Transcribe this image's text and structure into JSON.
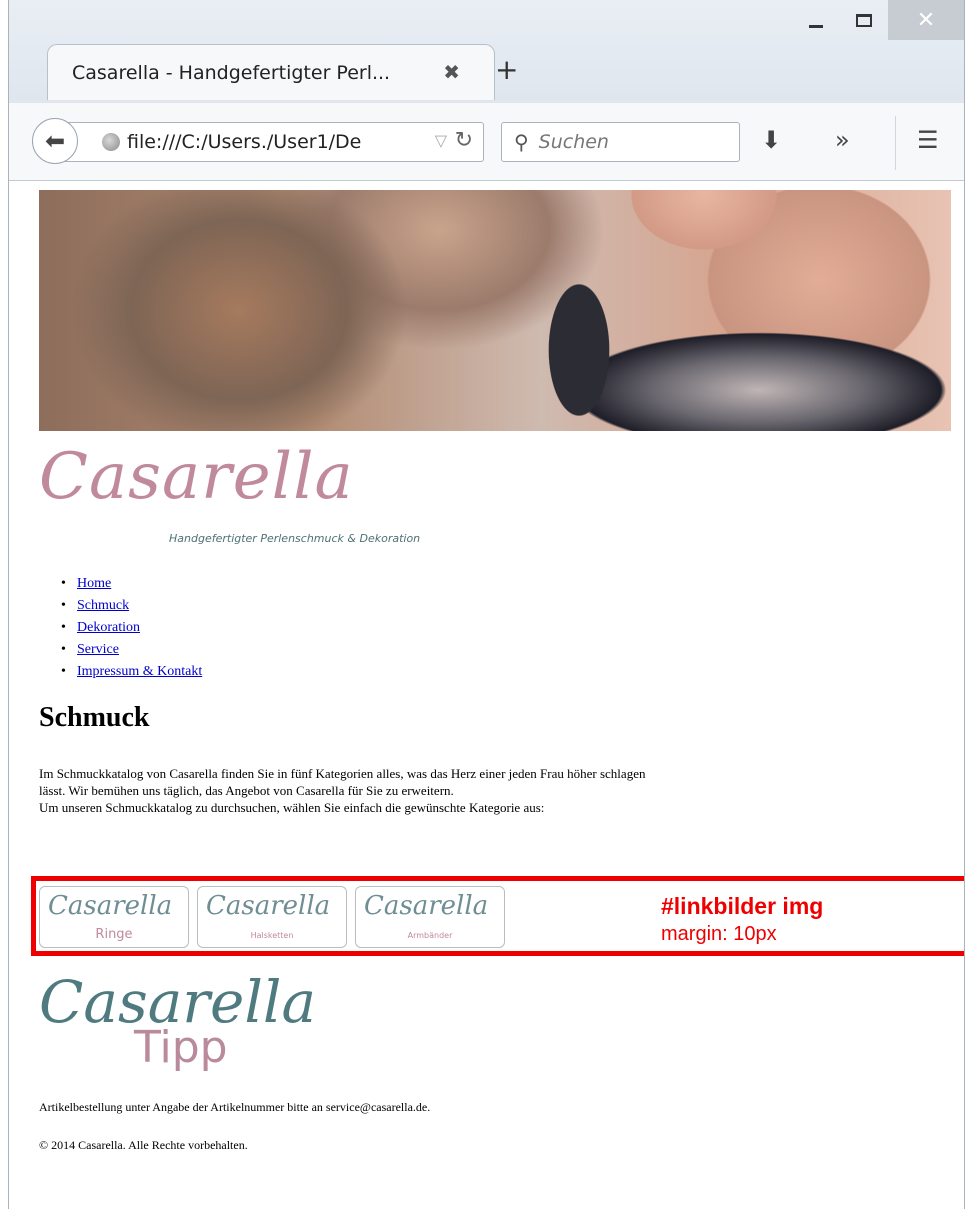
{
  "browser": {
    "tab_title": "Casarella - Handgefertigter Perl...",
    "url": "file:///C:/Users./User1/De",
    "search_placeholder": "Suchen",
    "new_tab_label": "+",
    "icons": [
      "back-icon",
      "globe-icon",
      "reload-icon",
      "search-icon",
      "download-icon",
      "overflow-icon",
      "menu-icon",
      "minimize-icon",
      "maximize-icon",
      "close-icon"
    ]
  },
  "page": {
    "logo_text": "Casarella",
    "logo_tagline": "Handgefertigter Perlenschmuck & Dekoration",
    "nav": [
      "Home",
      "Schmuck",
      "Dekoration",
      "Service",
      "Impressum & Kontakt"
    ],
    "title": "Schmuck",
    "intro_line1": "Im Schmuckkatalog von Casarella finden Sie in fünf Kategorien alles, was das Herz einer jeden Frau höher schlagen lässt. Wir bemühen uns täglich, das Angebot von Casarella für Sie zu erweitern.",
    "intro_line2": "Um unseren Schmuckkatalog zu durchsuchen, wählen Sie einfach die gewünschte Kategorie aus:",
    "link_images": [
      {
        "logo": "Casarella",
        "category": "Ringe"
      },
      {
        "logo": "Casarella",
        "category": "Halsketten"
      },
      {
        "logo": "Casarella",
        "category": "Armbänder"
      }
    ],
    "tipp_logo": "Casarella",
    "tipp_word": "Tipp",
    "order_note": "Artikelbestellung unter Angabe der Artikelnummer bitte an service@casarella.de.",
    "copyright": "© 2014 Casarella. Alle Rechte vorbehalten."
  },
  "annotation": {
    "title": "#linkbilder img",
    "subtitle": "margin: 10px",
    "color": "#ef0000"
  }
}
